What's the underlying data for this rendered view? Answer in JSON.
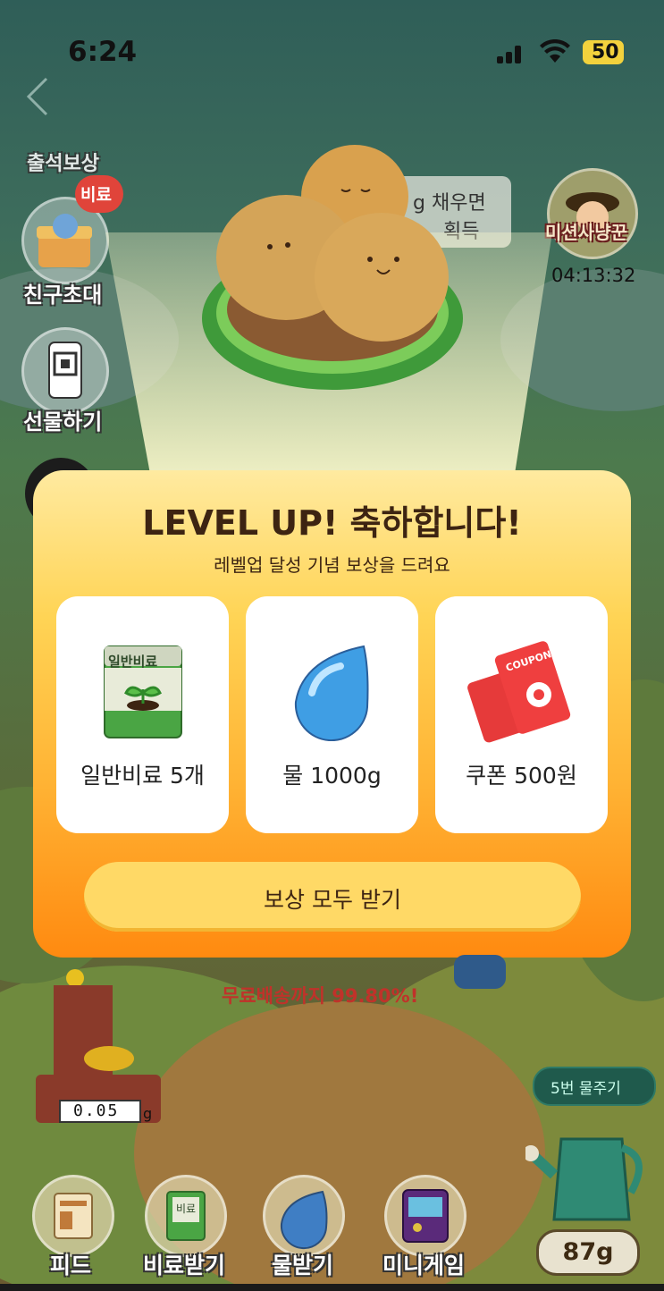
{
  "status_bar": {
    "time": "6:24",
    "battery": "50"
  },
  "sidebar": {
    "attendance_label": "출석보상",
    "fertilizer_badge": "비료",
    "invite_label": "친구초대",
    "gift_label": "선물하기"
  },
  "top": {
    "bubble_line1": "g 채우면",
    "bubble_line2": "획득",
    "mission_label": "미션사냥꾼",
    "mission_timer": "04:13:32"
  },
  "popup": {
    "title": "LEVEL UP! 축하합니다!",
    "subtitle": "레벨업 달성 기념 보상을 드려요",
    "rewards": [
      {
        "label": "일반비료 5개",
        "icon": "fertilizer-bag-icon",
        "bag_text": "일반비료"
      },
      {
        "label": "물 1000g",
        "icon": "water-drop-icon"
      },
      {
        "label": "쿠폰 500원",
        "icon": "coupon-icon",
        "coupon_text": "COUPON"
      }
    ],
    "claim_button": "보상 모두 받기"
  },
  "farm": {
    "shipping_progress": "무료배송까지 99.80%!",
    "gauge_value": "0.05",
    "gauge_unit": "g",
    "water_5_button": "5번 물주기",
    "water_amount": "87g"
  },
  "bottom_nav": [
    {
      "label": "피드"
    },
    {
      "label": "비료받기",
      "badge": "비료"
    },
    {
      "label": "물받기"
    },
    {
      "label": "미니게임"
    }
  ],
  "colors": {
    "popup_top": "#ffeaa0",
    "popup_bottom": "#ff8a10",
    "claim_button": "#ffd966",
    "title_text": "#3d2412",
    "shipping_text": "#c0322a"
  }
}
